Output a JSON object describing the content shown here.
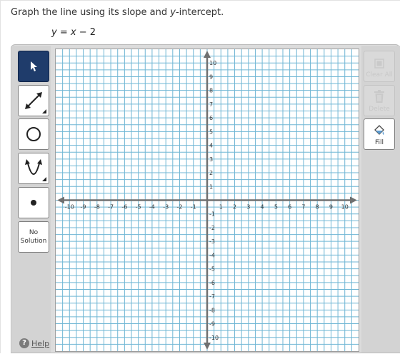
{
  "prompt": {
    "before": "Graph the line using its slope and ",
    "var": "y",
    "after": "-intercept."
  },
  "equation": {
    "lhs": "y",
    "eq": " = ",
    "rhs_var": "x",
    "rhs_rest": " − 2"
  },
  "tools": {
    "no_solution_line1": "No",
    "no_solution_line2": "Solution",
    "active": "pointer"
  },
  "right_panel": {
    "clear_all": "Clear All",
    "delete": "Delete",
    "fill": "Fill"
  },
  "help": {
    "label": "Help",
    "icon_text": "?"
  },
  "colors": {
    "grid_line": "#6fb6d4",
    "axis": "#707070",
    "active_tool": "#1f3c6b"
  },
  "chart_data": {
    "type": "coordinate-grid",
    "xlim": [
      -11,
      11
    ],
    "ylim": [
      -11,
      11
    ],
    "x_ticks": [
      -10,
      -9,
      -8,
      -7,
      -6,
      -5,
      -4,
      -3,
      -2,
      -1,
      1,
      2,
      3,
      4,
      5,
      6,
      7,
      8,
      9,
      10
    ],
    "y_ticks": [
      -10,
      -9,
      -8,
      -7,
      -6,
      -5,
      -4,
      -3,
      -2,
      -1,
      1,
      2,
      3,
      4,
      5,
      6,
      7,
      8,
      9,
      10
    ],
    "grid": true,
    "grid_step": 0.5
  }
}
